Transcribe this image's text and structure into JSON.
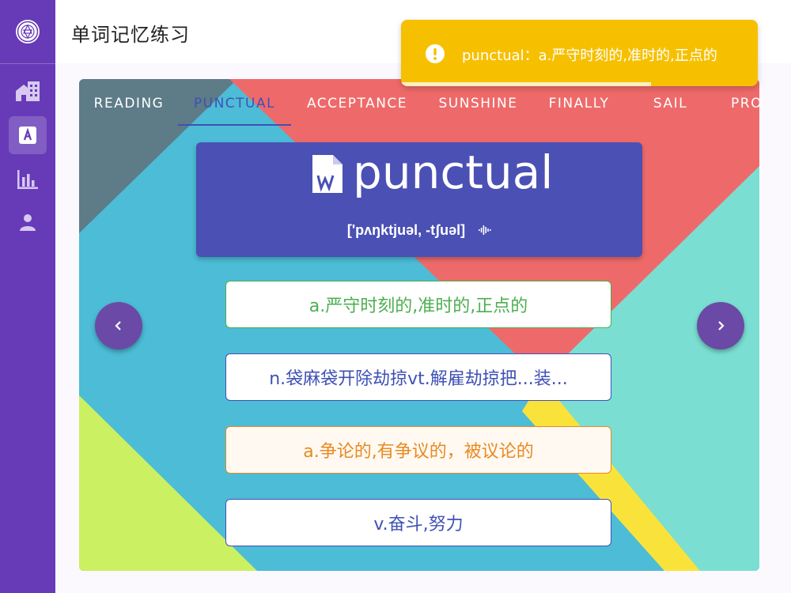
{
  "header": {
    "title": "单词记忆练习"
  },
  "sidebar": {
    "items": [
      {
        "icon": "buildings-icon",
        "active": false
      },
      {
        "icon": "letter-a-icon",
        "active": true
      },
      {
        "icon": "bar-chart-icon",
        "active": false
      },
      {
        "icon": "person-icon",
        "active": false
      }
    ]
  },
  "toast": {
    "text": "punctual：a.严守时刻的,准时的,正点的",
    "icon": "exclamation-circle-icon",
    "color": "#f6c000",
    "progress": 0.7
  },
  "tabs": {
    "items": [
      "READING",
      "PUNCTUAL",
      "ACCEPTANCE",
      "SUNSHINE",
      "FINALLY",
      "SAIL",
      "PRO"
    ],
    "active_index": 1,
    "active_color": "#3f51b5"
  },
  "word": {
    "text": "punctual",
    "phonetic": "['pʌŋktjuəl, -tʃuəl]",
    "icon": "word-doc-icon",
    "sound_icon": "sound-wave-icon"
  },
  "options": [
    {
      "text": "a.严守时刻的,准时的,正点的",
      "state": "correct"
    },
    {
      "text": "n.袋麻袋开除劫掠vt.解雇劫掠把...装...",
      "state": "default"
    },
    {
      "text": "a.争论的,有争议的，被议论的",
      "state": "warn"
    },
    {
      "text": "v.奋斗,努力",
      "state": "default"
    }
  ],
  "nav": {
    "prev_icon": "chevron-left-icon",
    "next_icon": "chevron-right-icon"
  }
}
